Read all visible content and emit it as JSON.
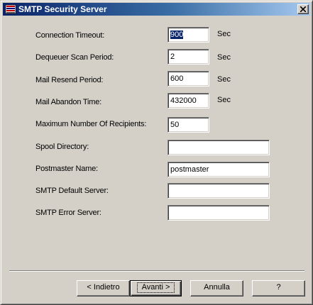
{
  "window": {
    "title": "SMTP Security Server"
  },
  "form": {
    "connection_timeout": {
      "label": "Connection Timeout:",
      "value": "900",
      "unit": "Sec"
    },
    "dequeuer_scan_period": {
      "label": "Dequeuer Scan Period:",
      "value": "2",
      "unit": "Sec"
    },
    "mail_resend_period": {
      "label": "Mail Resend Period:",
      "value": "600",
      "unit": "Sec"
    },
    "mail_abandon_time": {
      "label": "Mail Abandon Time:",
      "value": "432000",
      "unit": "Sec"
    },
    "max_recipients": {
      "label": "Maximum Number Of Recipients:",
      "value": "50"
    },
    "spool_directory": {
      "label": "Spool Directory:",
      "value": ""
    },
    "postmaster_name": {
      "label": "Postmaster Name:",
      "value": "postmaster"
    },
    "smtp_default_server": {
      "label": "SMTP Default Server:",
      "value": ""
    },
    "smtp_error_server": {
      "label": "SMTP Error Server:",
      "value": ""
    }
  },
  "buttons": {
    "back": "< Indietro",
    "next": "Avanti >",
    "cancel": "Annulla",
    "help": "?"
  },
  "icons": {
    "app": "smtp-server-icon",
    "close": "close-icon"
  }
}
